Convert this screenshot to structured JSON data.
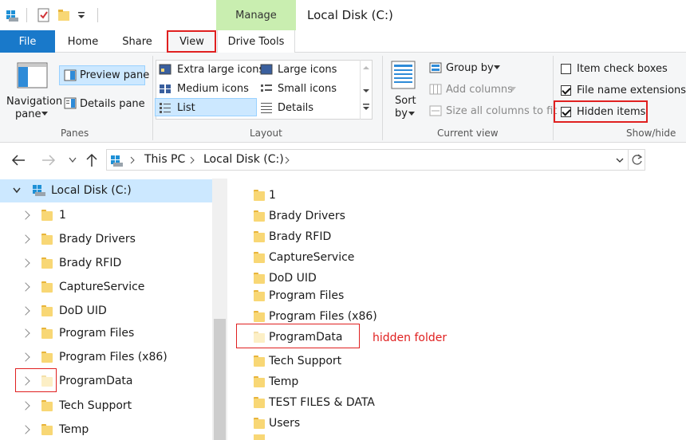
{
  "window": {
    "title": "Local Disk (C:)",
    "context_tab": "Manage"
  },
  "tabs": {
    "file": "File",
    "home": "Home",
    "share": "Share",
    "view": "View",
    "drive_tools": "Drive Tools"
  },
  "ribbon": {
    "panes": {
      "navigation_pane": "Navigation",
      "navigation_pane2": "pane",
      "preview_pane": "Preview pane",
      "details_pane": "Details pane",
      "label": "Panes"
    },
    "layout": {
      "extra_large": "Extra large icons",
      "large": "Large icons",
      "medium": "Medium icons",
      "small": "Small icons",
      "list": "List",
      "details": "Details",
      "label": "Layout"
    },
    "current_view": {
      "sort": "Sort",
      "sort2": "by",
      "group_by": "Group by",
      "add_columns": "Add columns",
      "size_all": "Size all columns to fit",
      "label": "Current view"
    },
    "show_hide": {
      "item_check": "Item check boxes",
      "file_ext": "File name extensions",
      "hidden_items": "Hidden items",
      "label": "Show/hide",
      "item_check_on": false,
      "file_ext_on": true,
      "hidden_on": true
    }
  },
  "address": {
    "this_pc": "This PC",
    "local_disk": "Local Disk (C:)"
  },
  "nav": {
    "root": "Local Disk (C:)",
    "items": [
      "1",
      "Brady Drivers",
      "Brady RFID",
      "CaptureService",
      "DoD UID",
      "Program Files",
      "Program Files (x86)",
      "ProgramData",
      "Tech Support",
      "Temp"
    ]
  },
  "files": [
    "1",
    "Brady Drivers",
    "Brady RFID",
    "CaptureService",
    "DoD UID",
    "Program Files",
    "Program Files (x86)",
    "ProgramData",
    "Tech Support",
    "Temp",
    "TEST FILES & DATA",
    "Users"
  ],
  "annotation": {
    "hidden_folder": "hidden folder"
  },
  "colors": {
    "accent": "#1979ca",
    "highlight": "#e02020",
    "manage": "#c9eeb0"
  }
}
